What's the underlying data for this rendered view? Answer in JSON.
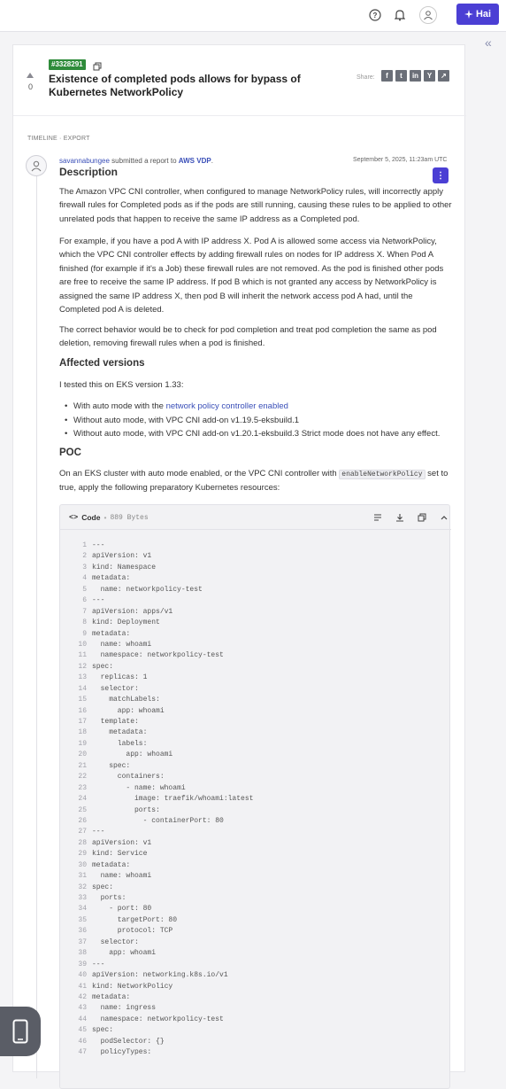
{
  "topbar": {
    "help_icon": "help-circle-icon",
    "notifications_icon": "bell-icon",
    "user_icon": "user-avatar-icon",
    "hai_button_label": "Hai"
  },
  "report": {
    "id": "#3328291",
    "vote_count": "0",
    "title": "Existence of completed pods allows for bypass of Kubernetes NetworkPolicy",
    "share_label": "Share:",
    "share_buttons": [
      "f",
      "t",
      "in",
      "Y",
      "↗"
    ]
  },
  "timeline": {
    "label": "TIMELINE · EXPORT"
  },
  "activity": {
    "author": "savannabungee",
    "action_text": " submitted a report to ",
    "program": "AWS VDP",
    "after_program": ".",
    "date": "September 5, 2025, 11:23am UTC"
  },
  "description": {
    "heading": "Description",
    "p1": "The Amazon VPC CNI controller, when configured to manage NetworkPolicy rules, will incorrectly apply firewall rules for Completed pods as if the pods are still running, causing these rules to be applied to other unrelated pods that happen to receive the same IP address as a Completed pod.",
    "p2": "For example, if you have a pod A with IP address X. Pod A is allowed some access via NetworkPolicy, which the VPC CNI controller effects by adding firewall rules on nodes for IP address X. When Pod A finished (for example if it's a Job) these firewall rules are not removed. As the pod is finished other pods are free to receive the same IP address. If pod B which is not granted any access by NetworkPolicy is assigned the same IP address X, then pod B will inherit the network access pod A had, until the Completed pod A is deleted.",
    "p3": "The correct behavior would be to check for pod completion and treat pod completion the same as pod deletion, removing firewall rules when a pod is finished.",
    "affected_heading": "Affected versions",
    "tested_line": "I tested this on EKS version 1.33:",
    "bullet1_prefix": "With auto mode with the ",
    "bullet1_link": "network policy controller enabled",
    "bullet2": "Without auto mode, with VPC CNI add-on v1.19.5-eksbuild.1",
    "bullet3": "Without auto mode, with VPC CNI add-on v1.20.1-eksbuild.3 Strict mode does not have any effect.",
    "poc_heading": "POC",
    "poc_p1_before": "On an EKS cluster with auto mode enabled, or the VPC CNI controller with ",
    "poc_p1_code": "enableNetworkPolicy",
    "poc_p1_after": " set to true, apply the following preparatory Kubernetes resources:"
  },
  "code": {
    "label": "Code",
    "separator": "•",
    "size": "889 Bytes",
    "actions": [
      "wrap-lines-icon",
      "download-icon",
      "copy-icon",
      "collapse-icon"
    ],
    "lines": [
      "---",
      "apiVersion: v1",
      "kind: Namespace",
      "metadata:",
      "  name: networkpolicy-test",
      "---",
      "apiVersion: apps/v1",
      "kind: Deployment",
      "metadata:",
      "  name: whoami",
      "  namespace: networkpolicy-test",
      "spec:",
      "  replicas: 1",
      "  selector:",
      "    matchLabels:",
      "      app: whoami",
      "  template:",
      "    metadata:",
      "      labels:",
      "        app: whoami",
      "    spec:",
      "      containers:",
      "        - name: whoami",
      "          image: traefik/whoami:latest",
      "          ports:",
      "            - containerPort: 80",
      "---",
      "apiVersion: v1",
      "kind: Service",
      "metadata:",
      "  name: whoami",
      "spec:",
      "  ports:",
      "    - port: 80",
      "      targetPort: 80",
      "      protocol: TCP",
      "  selector:",
      "    app: whoami",
      "---",
      "apiVersion: networking.k8s.io/v1",
      "kind: NetworkPolicy",
      "metadata:",
      "  name: ingress",
      "  namespace: networkpolicy-test",
      "spec:",
      "  podSelector: {}",
      "  policyTypes:"
    ]
  },
  "floating": {
    "icon": "tablet-icon"
  },
  "colors": {
    "accent": "#4b3fd4",
    "report_id_badge": "#2e8b3a",
    "link": "#3a4fb8"
  }
}
